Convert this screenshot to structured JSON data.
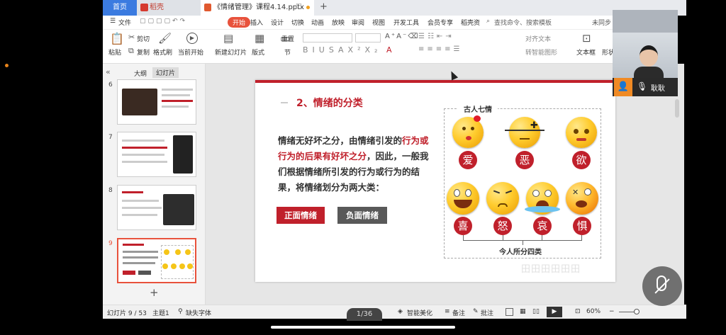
{
  "tabs": {
    "home": "首页",
    "wps": "稻壳",
    "doc": "《情绪管理》课程4.14.pptx",
    "add": "+"
  },
  "menu": {
    "file": "文件",
    "items": [
      "开始",
      "插入",
      "设计",
      "切换",
      "动画",
      "放映",
      "审阅",
      "视图",
      "开发工具",
      "会员专享",
      "稻壳资"
    ],
    "search": "查找命令、搜索模板",
    "sync": "未同步"
  },
  "toolbar": {
    "paste": "粘贴",
    "cut": "剪切",
    "copy": "复制",
    "format_painter": "格式刷",
    "from_current": "当前开始",
    "new_slide": "新建幻灯片",
    "layout": "版式",
    "section": "节",
    "reset": "重置",
    "text_box": "文本框",
    "shape": "形状",
    "align_text": "对齐文本",
    "convert_smartart": "转智能图形"
  },
  "sidepanel": {
    "outline_tab": "大纲",
    "slides_tab": "幻灯片",
    "slide_numbers": [
      "6",
      "7",
      "8",
      "9"
    ],
    "add_button": "+"
  },
  "slide": {
    "title": "2、情绪的分类",
    "body_part1": "情绪无好坏之分，由情绪引发的",
    "body_highlight": "行为或行为的后果有好坏之分",
    "body_part2": "，因此，一般我们根据情绪所引发的行为或行为的结果，将情绪划分为两大类：",
    "btn_positive": "正面情绪",
    "btn_negative": "负面情绪",
    "seven_emotions_label": "古人七情",
    "seven_emotions": [
      "爱",
      "恶",
      "欲"
    ],
    "four_emotions": [
      "喜",
      "怒",
      "哀",
      "惧"
    ],
    "four_emotions_label": "今人所分四类",
    "watermark": "田田田田田田"
  },
  "video": {
    "name": "耿耿"
  },
  "statusbar": {
    "slide_info": "幻灯片 9 / 53",
    "theme": "主题1",
    "missing_font": "缺失字体",
    "page_counter": "1/36",
    "beautify": "智能美化",
    "notes": "备注",
    "comments": "批注",
    "zoom": "60%"
  },
  "colors": {
    "accent_red": "#c0202b",
    "dark_gray_btn": "#595959",
    "tab_blue": "#3b7be0",
    "start_orange": "#e8523c"
  }
}
